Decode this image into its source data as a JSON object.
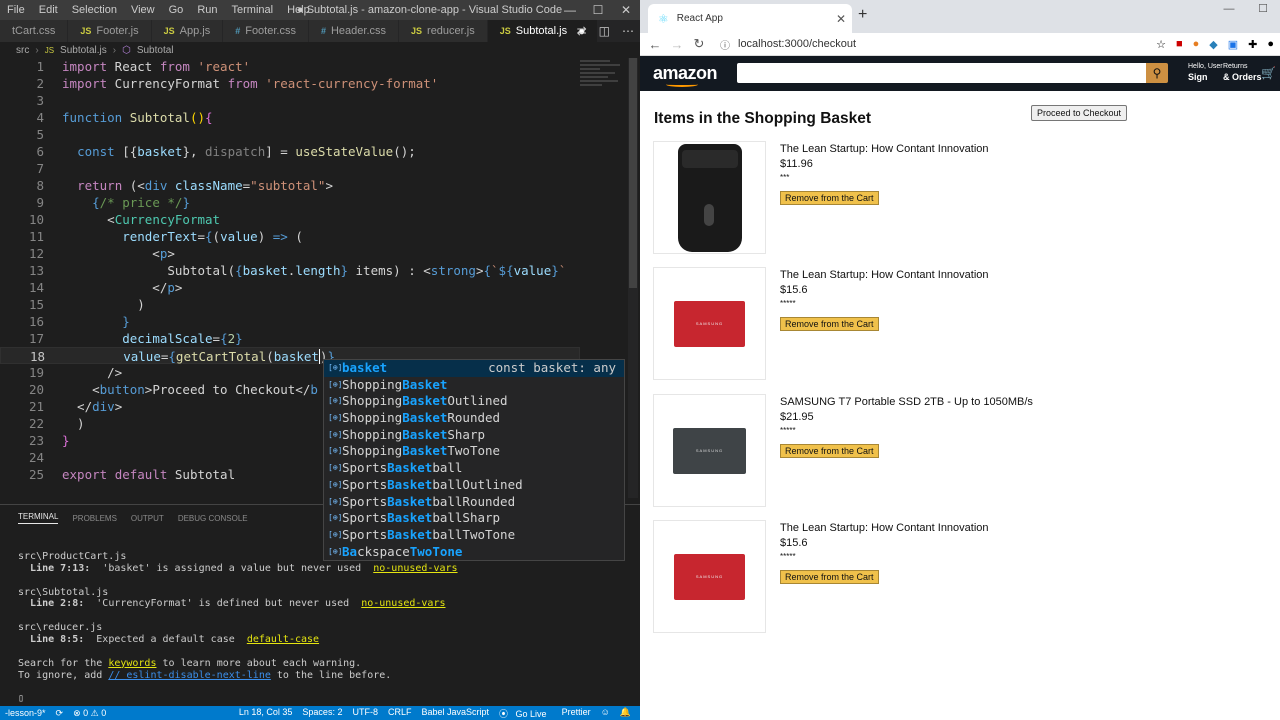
{
  "vscode": {
    "menu": [
      "File",
      "Edit",
      "Selection",
      "View",
      "Go",
      "Run",
      "Terminal",
      "Help"
    ],
    "window_title": "● Subtotal.js - amazon-clone-app - Visual Studio Code",
    "tabs": [
      {
        "label": "tCart.css",
        "icon": "css"
      },
      {
        "label": "Footer.js",
        "icon": "js"
      },
      {
        "label": "App.js",
        "icon": "js"
      },
      {
        "label": "Footer.css",
        "icon": "css"
      },
      {
        "label": "Header.css",
        "icon": "css"
      },
      {
        "label": "reducer.js",
        "icon": "js"
      },
      {
        "label": "Subtotal.js",
        "icon": "js",
        "active": true
      }
    ],
    "breadcrumb": [
      "src",
      "Subtotal.js",
      "Subtotal"
    ],
    "current_line": 18,
    "suggestions": [
      {
        "pre": "",
        "hl": "basket",
        "post": "",
        "detail": "const basket: any"
      },
      {
        "pre": "Shopping",
        "hl": "Basket",
        "post": ""
      },
      {
        "pre": "Shopping",
        "hl": "Basket",
        "post": "Outlined"
      },
      {
        "pre": "Shopping",
        "hl": "Basket",
        "post": "Rounded"
      },
      {
        "pre": "Shopping",
        "hl": "Basket",
        "post": "Sharp"
      },
      {
        "pre": "Shopping",
        "hl": "Basket",
        "post": "TwoTone"
      },
      {
        "pre": "Sports",
        "hl": "Basket",
        "post": "ball"
      },
      {
        "pre": "Sports",
        "hl": "Basket",
        "post": "ballOutlined"
      },
      {
        "pre": "Sports",
        "hl": "Basket",
        "post": "ballRounded"
      },
      {
        "pre": "Sports",
        "hl": "Basket",
        "post": "ballSharp"
      },
      {
        "pre": "Sports",
        "hl": "Basket",
        "post": "ballTwoTone"
      },
      {
        "pre": "Ba",
        "hl": "ckspace",
        "post": "TwoTone"
      }
    ],
    "panel_tabs": [
      "TERMINAL",
      "PROBLEMS",
      "OUTPUT",
      "DEBUG CONSOLE"
    ],
    "terminal": [
      {
        "file": "src\\ProductCart.js",
        "loc": "Line 7:13:",
        "msg": "'basket' is assigned a value but never used",
        "rule": "no-unused-vars"
      },
      {
        "file": "src\\Subtotal.js",
        "loc": "Line 2:8:",
        "msg": "'CurrencyFormat' is defined but never used",
        "rule": "no-unused-vars"
      },
      {
        "file": "src\\reducer.js",
        "loc": "Line 8:5:",
        "msg": "Expected a default case",
        "rule": "default-case"
      }
    ],
    "terminal_footer1_pre": "Search for the ",
    "terminal_footer1_kw": "keywords",
    "terminal_footer1_post": " to learn more about each warning.",
    "terminal_footer2_pre": "To ignore, add ",
    "terminal_footer2_kw": "// eslint-disable-next-line",
    "terminal_footer2_post": " to the line before.",
    "terminal_prompt": "▯",
    "status": {
      "branch": "-lesson-9*",
      "errors": "⊗ 0 ⚠ 0",
      "position": "Ln 18, Col 35",
      "spaces": "Spaces: 2",
      "encoding": "UTF-8",
      "eol": "CRLF",
      "language": "Babel JavaScript",
      "golive": "Go Live",
      "prettier": "Prettier"
    }
  },
  "browser": {
    "tab_title": "React App",
    "url": "localhost:3000/checkout",
    "amazon": {
      "logo": "amazon",
      "hello": "Hello, User",
      "signin": "Sign",
      "returns": "Returns",
      "orders": "& Orders"
    },
    "heading": "Items in the Shopping Basket",
    "proceed_label": "Proceed to Checkout",
    "items": [
      {
        "title": "The Lean Startup: How Contant Innovation",
        "price": "$11.96",
        "rating": "***",
        "image": "shredder",
        "remove_label": "Remove from the Cart"
      },
      {
        "title": "The Lean Startup: How Contant Innovation",
        "price": "$15.6",
        "rating": "*****",
        "image": "ssd-red",
        "remove_label": "Remove from the Cart"
      },
      {
        "title": "SAMSUNG T7 Portable SSD 2TB - Up to 1050MB/s",
        "price": "$21.95",
        "rating": "*****",
        "image": "ssd-gray",
        "remove_label": "Remove from the Cart"
      },
      {
        "title": "The Lean Startup: How Contant Innovation",
        "price": "$15.6",
        "rating": "*****",
        "image": "ssd-red",
        "remove_label": "Remove from the Cart"
      }
    ],
    "ssd_brand": "SAMSUNG"
  }
}
